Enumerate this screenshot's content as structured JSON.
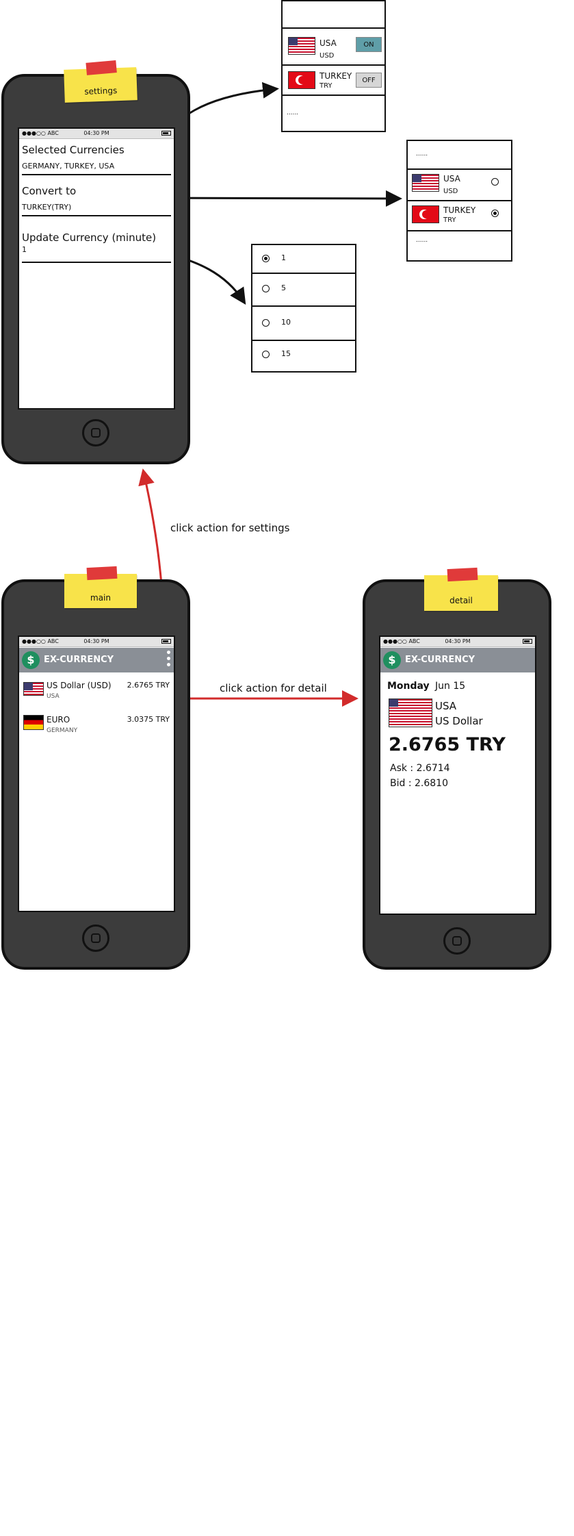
{
  "settings_phone": {
    "sticky_label": "settings",
    "status": {
      "signal": "●●●○○ ABC",
      "time": "04:30 PM"
    },
    "rows": [
      {
        "title": "Selected Currencies",
        "value": "GERMANY, TURKEY, USA"
      },
      {
        "title": "Convert to",
        "value": "TURKEY(TRY)"
      },
      {
        "title": "Update Currency (minute)",
        "value": "1"
      }
    ]
  },
  "currency_toggle_popup": {
    "items": [
      {
        "name": "USA",
        "code": "USD",
        "toggle": "ON",
        "flag": "us-flag"
      },
      {
        "name": "TURKEY",
        "code": "TRY",
        "toggle": "OFF",
        "flag": "tr-flag"
      }
    ],
    "more": "......"
  },
  "convert_popup": {
    "top_more": "......",
    "items": [
      {
        "name": "USA",
        "code": "USD",
        "selected": false,
        "flag": "us-flag"
      },
      {
        "name": "TURKEY",
        "code": "TRY",
        "selected": true,
        "flag": "tr-flag"
      }
    ],
    "bottom_more": "......"
  },
  "interval_popup": {
    "options": [
      {
        "label": "1",
        "selected": true
      },
      {
        "label": "5",
        "selected": false
      },
      {
        "label": "10",
        "selected": false
      },
      {
        "label": "15",
        "selected": false
      }
    ]
  },
  "annotations": {
    "settings_action": "click action for settings",
    "detail_action": "click action for detail"
  },
  "main_phone": {
    "sticky_label": "main",
    "status": {
      "signal": "●●●○○ ABC",
      "time": "04:30 PM"
    },
    "app_title": "EX-CURRENCY",
    "logo_glyph": "$",
    "list": [
      {
        "name": "US Dollar (USD)",
        "country": "USA",
        "rate": "2.6765 TRY",
        "flag": "us-flag"
      },
      {
        "name": "EURO",
        "country": "GERMANY",
        "rate": "3.0375 TRY",
        "flag": "de-flag"
      }
    ]
  },
  "detail_phone": {
    "sticky_label": "detail",
    "status": {
      "signal": "●●●○○ ABC",
      "time": "04:30 PM"
    },
    "app_title": "EX-CURRENCY",
    "logo_glyph": "$",
    "day": "Monday",
    "date": "Jun 15",
    "country": "USA",
    "currency_name": "US Dollar",
    "rate": "2.6765 TRY",
    "ask": "Ask : 2.6714",
    "bid": "Bid :  2.6810"
  },
  "colors": {
    "arrow_black": "#111111",
    "arrow_red": "#d22b2b",
    "appbar": "#8a8f96",
    "toggle_on": "#5f9ea8"
  }
}
